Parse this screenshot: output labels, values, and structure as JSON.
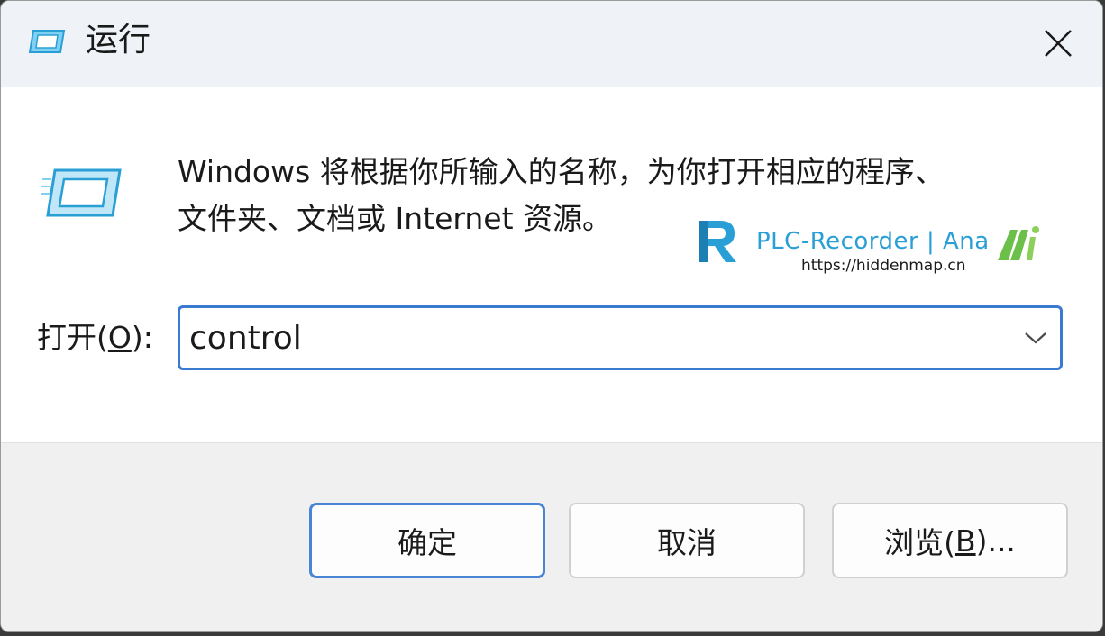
{
  "window": {
    "title": "运行",
    "title_icon": "run-icon",
    "close_icon": "close-icon"
  },
  "content": {
    "message_line1": "Windows 将根据你所输入的名称，为你打开相应的程序、",
    "message_line2": "文件夹、文档或 Internet 资源。",
    "big_icon": "run-icon"
  },
  "open_field": {
    "label_prefix": "打开(",
    "label_accel": "O",
    "label_suffix": "):",
    "value": "control",
    "dropdown_icon": "chevron-down-icon"
  },
  "buttons": {
    "ok": "确定",
    "cancel": "取消",
    "browse_prefix": "浏览(",
    "browse_accel": "B",
    "browse_suffix": ")..."
  },
  "watermark": {
    "brand": "PLC-Recorder | Ana",
    "url": "https://hiddenmap.cn"
  },
  "colors": {
    "accent": "#3a7ad1",
    "icon": "#2aa8e0",
    "watermark": "#2a9fd6",
    "watermark_green": "#6cc04a"
  }
}
